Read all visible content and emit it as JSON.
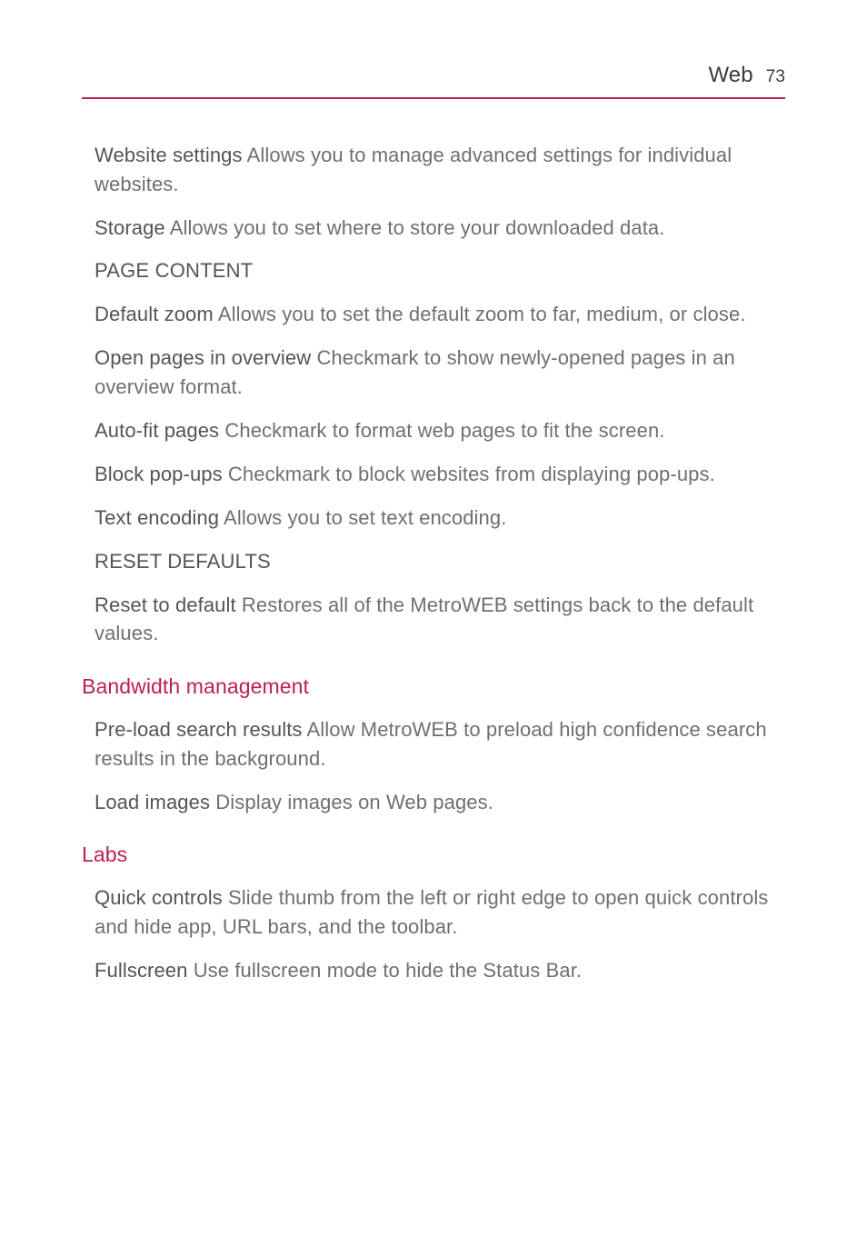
{
  "header": {
    "title": "Web",
    "page": "73"
  },
  "items": {
    "website_settings": {
      "label": "Website settings",
      "desc": "  Allows you to manage advanced settings for individual websites."
    },
    "storage": {
      "label": "Storage",
      "desc": "  Allows you to set where to store your downloaded data."
    },
    "page_content_head": "PAGE CONTENT",
    "default_zoom": {
      "label": "Default zoom",
      "desc": "  Allows you to set the default zoom to far, medium, or close."
    },
    "open_overview": {
      "label": "Open pages in overview",
      "desc": "  Checkmark to show newly-opened pages in an overview format."
    },
    "auto_fit": {
      "label": "Auto-fit pages",
      "desc": "  Checkmark to format web pages to fit the screen."
    },
    "block_popups": {
      "label": "Block pop-ups",
      "desc": "  Checkmark to block websites from displaying pop-ups."
    },
    "text_encoding": {
      "label": "Text encoding",
      "desc": "  Allows you to set text encoding."
    },
    "reset_head": "RESET DEFAULTS",
    "reset_default": {
      "label": "Reset to default",
      "desc": "  Restores all of the MetroWEB settings back to the default values."
    }
  },
  "bandwidth": {
    "heading": "Bandwidth management",
    "preload": {
      "label": "Pre-load search results",
      "desc": " Allow MetroWEB to preload high confidence search results in the background."
    },
    "load_images": {
      "label": "Load images",
      "desc": " Display images on Web pages."
    }
  },
  "labs": {
    "heading": "Labs",
    "quick_controls": {
      "label": "Quick controls",
      "desc": " Slide thumb from the left or right edge to open quick controls and hide app, URL bars, and the toolbar."
    },
    "fullscreen": {
      "label": "Fullscreen",
      "desc": " Use fullscreen mode to hide the Status Bar."
    }
  }
}
